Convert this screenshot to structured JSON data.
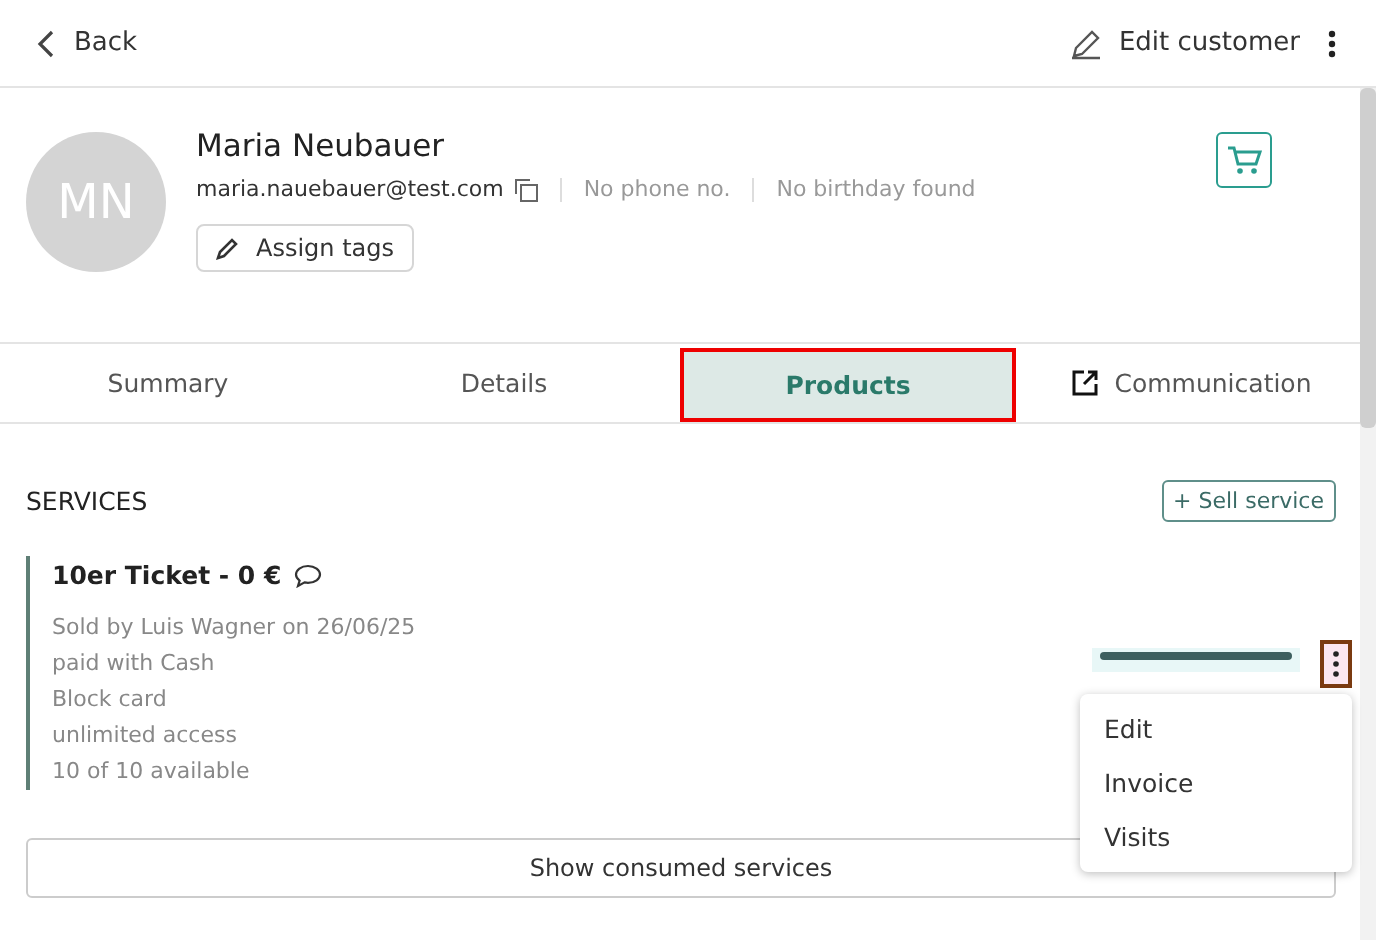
{
  "header": {
    "back": "Back",
    "edit": "Edit customer"
  },
  "customer": {
    "initials": "MN",
    "name": "Maria Neubauer",
    "email": "maria.nauebauer@test.com",
    "phone": "No phone no.",
    "birthday": "No birthday found",
    "assign_tags": "Assign tags"
  },
  "tabs": [
    {
      "label": "Summary",
      "selected": false,
      "external": false,
      "highlighted": false
    },
    {
      "label": "Details",
      "selected": false,
      "external": false,
      "highlighted": false
    },
    {
      "label": "Products",
      "selected": true,
      "external": false,
      "highlighted": true
    },
    {
      "label": "Communication",
      "selected": false,
      "external": true,
      "highlighted": false
    }
  ],
  "services": {
    "heading": "SERVICES",
    "sell_button": "+ Sell service",
    "items": [
      {
        "title": "10er Ticket - 0 €",
        "lines": [
          "Sold by Luis Wagner on 26/06/25",
          "paid with Cash",
          "Block card",
          "unlimited access",
          "10 of 10 available"
        ],
        "level": 1,
        "menu_open": true
      }
    ],
    "show_consumed": "Show consumed services"
  },
  "menu": [
    "Edit",
    "Invoice",
    "Visits"
  ]
}
